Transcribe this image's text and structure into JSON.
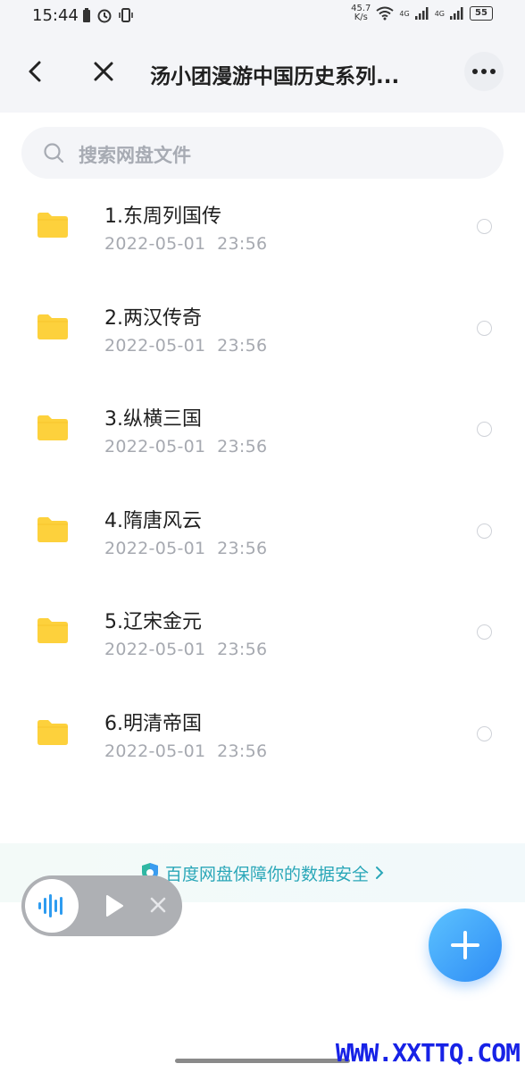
{
  "status_bar": {
    "time": "15:44",
    "net_speed_value": "45.7",
    "net_speed_unit": "K/s",
    "network_1": "4G",
    "network_2": "4G",
    "battery": "55"
  },
  "nav": {
    "title": "汤小团漫游中国历史系列...",
    "back_icon": "chevron-left-icon",
    "close_icon": "close-icon",
    "more_icon": "more-horizontal-icon"
  },
  "search": {
    "placeholder": "搜索网盘文件"
  },
  "files": [
    {
      "name": "1.东周列国传",
      "date": "2022-05-01",
      "time": "23:56"
    },
    {
      "name": "2.两汉传奇",
      "date": "2022-05-01",
      "time": "23:56"
    },
    {
      "name": "3.纵横三国",
      "date": "2022-05-01",
      "time": "23:56"
    },
    {
      "name": "4.隋唐风云",
      "date": "2022-05-01",
      "time": "23:56"
    },
    {
      "name": "5.辽宋金元",
      "date": "2022-05-01",
      "time": "23:56"
    },
    {
      "name": "6.明清帝国",
      "date": "2022-05-01",
      "time": "23:56"
    }
  ],
  "security_banner": {
    "text": "百度网盘保障你的数据安全"
  },
  "colors": {
    "accent": "#2e8cf5",
    "folder": "#fdd13c",
    "banner_text": "#2aa7b8"
  },
  "watermark": "WWW.XXTTQ.COM"
}
